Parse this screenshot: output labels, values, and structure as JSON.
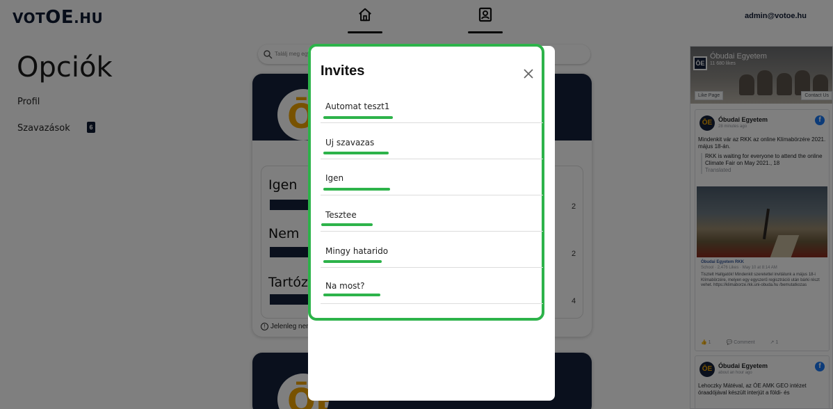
{
  "header": {
    "logo_small": "VOT",
    "logo_big": "OE",
    "logo_suffix": ".HU",
    "user_email": "admin@votoe.hu"
  },
  "sidebar": {
    "title": "Opciók",
    "items": [
      {
        "label": "Profil"
      },
      {
        "label": "Szavazások",
        "badge": "6"
      }
    ]
  },
  "feed": {
    "search_placeholder": "Találj meg egy szavazást",
    "card1": {
      "options": [
        {
          "label": "Igen",
          "count": "2"
        },
        {
          "label": "Nem",
          "count": "2"
        },
        {
          "label": "Tartózkodom",
          "count": "4"
        }
      ],
      "note": "Jelenleg nem"
    },
    "logo_text": "ŌE"
  },
  "facebook": {
    "page_name": "Óbudai Egyetem",
    "page_likes": "11 680 likes",
    "like_page": "Like Page",
    "contact_us": "Contact Us",
    "post1": {
      "author": "Óbudai Egyetem",
      "time": "28 minutes ago",
      "text": "Mindenkit vár az RKK az online Klímabörzére 2021. május 18-án.",
      "translation": "RKK is waiting for everyone to attend the online Climate Fair on May 2021., 18",
      "translated_label": "Translated",
      "shared_name": "Óbudai Egyetem RKK",
      "shared_meta": "School · 2,476 Likes · May 10 at 8:14 AM",
      "shared_text": "Tisztelt Hallgatók! Mindenkit szeretettel invitálunk a május 18-i Klímabörzére, melyen egy egyszerű regisztráció után bárki részt vehet. https://klimaborze.rkk.uni-obuda.hu /bemutatkozas",
      "likes": "1",
      "comment": "Comment",
      "shares": "1"
    },
    "post2": {
      "author": "Óbudai Egyetem",
      "time": "about an hour ago",
      "text": "Lehoczky Mátéval, az ÓE AMK GEO intézet óraadójával készült interjút a földi- és"
    }
  },
  "modal": {
    "title": "Invites",
    "invites": [
      {
        "label": "Automat teszt1"
      },
      {
        "label": "Uj szavazas"
      },
      {
        "label": "Igen"
      },
      {
        "label": "Tesztee"
      },
      {
        "label": "Mingy hatarido"
      },
      {
        "label": "Na most?"
      }
    ],
    "accent_color": "#2db34a"
  },
  "icons": [
    "home-icon",
    "profile-card-icon",
    "search-icon",
    "close-icon",
    "info-icon",
    "facebook-icon"
  ]
}
